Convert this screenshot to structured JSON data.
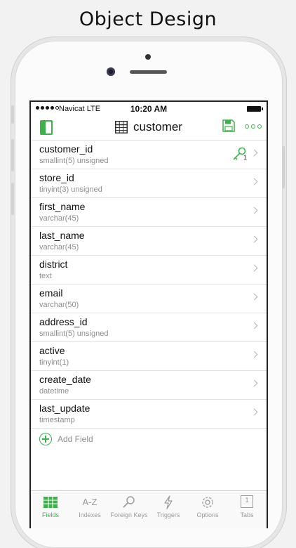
{
  "promo": {
    "title": "Object Design"
  },
  "statusbar": {
    "carrier": "Navicat LTE",
    "time": "10:20 AM"
  },
  "navbar": {
    "title": "customer",
    "left_icon": "sidebar-toggle-icon",
    "center_icon": "table-icon",
    "right_icons": [
      "save-icon",
      "more-icon"
    ]
  },
  "fields": [
    {
      "name": "customer_id",
      "type": "smallint(5) unsigned",
      "primary_key": true,
      "key_index": "1"
    },
    {
      "name": "store_id",
      "type": "tinyint(3) unsigned"
    },
    {
      "name": "first_name",
      "type": "varchar(45)"
    },
    {
      "name": "last_name",
      "type": "varchar(45)"
    },
    {
      "name": "district",
      "type": "text"
    },
    {
      "name": "email",
      "type": "varchar(50)"
    },
    {
      "name": "address_id",
      "type": "smallint(5) unsigned"
    },
    {
      "name": "active",
      "type": "tinyint(1)"
    },
    {
      "name": "create_date",
      "type": "datetime"
    },
    {
      "name": "last_update",
      "type": "timestamp"
    }
  ],
  "add_field": {
    "label": "Add Field"
  },
  "tabs": [
    {
      "label": "Fields",
      "icon": "fields-icon",
      "active": true
    },
    {
      "label": "Indexes",
      "icon": "a-z-icon",
      "glyph": "A-Z"
    },
    {
      "label": "Foreign Keys",
      "icon": "magnifier-icon"
    },
    {
      "label": "Triggers",
      "icon": "lightning-icon"
    },
    {
      "label": "Options",
      "icon": "gear-icon"
    },
    {
      "label": "Tabs",
      "icon": "tabs-icon",
      "count": "1"
    }
  ],
  "colors": {
    "accent": "#3db24a",
    "muted": "#9a9a9a",
    "divider": "#e2e2e2"
  }
}
